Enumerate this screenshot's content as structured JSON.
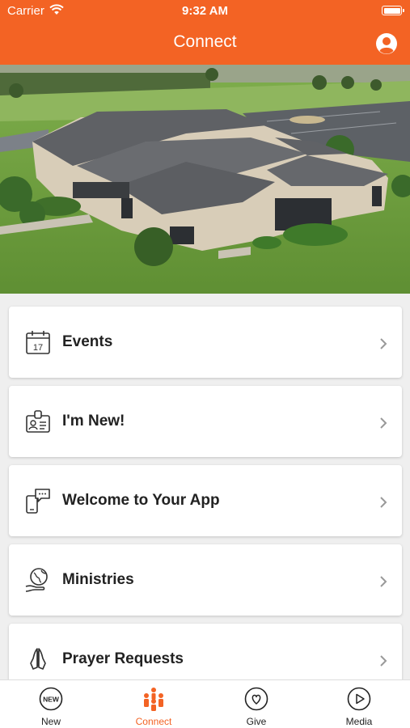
{
  "status_bar": {
    "carrier": "Carrier",
    "time": "9:32 AM"
  },
  "header": {
    "title": "Connect"
  },
  "colors": {
    "accent": "#f36324",
    "card": "#ffffff",
    "background": "#efefef"
  },
  "menu": {
    "items": [
      {
        "label": "Events",
        "icon": "calendar-icon",
        "date_number": "17"
      },
      {
        "label": "I'm New!",
        "icon": "id-badge-icon"
      },
      {
        "label": "Welcome to Your App",
        "icon": "phone-chat-icon"
      },
      {
        "label": "Ministries",
        "icon": "globe-hand-icon"
      },
      {
        "label": "Prayer Requests",
        "icon": "praying-hands-icon"
      }
    ]
  },
  "tabbar": {
    "new_badge": "NEW",
    "tabs": [
      {
        "label": "New",
        "icon": "new-badge-icon",
        "active": false
      },
      {
        "label": "Connect",
        "icon": "people-icon",
        "active": true
      },
      {
        "label": "Give",
        "icon": "heart-icon",
        "active": false
      },
      {
        "label": "Media",
        "icon": "play-icon",
        "active": false
      }
    ]
  }
}
